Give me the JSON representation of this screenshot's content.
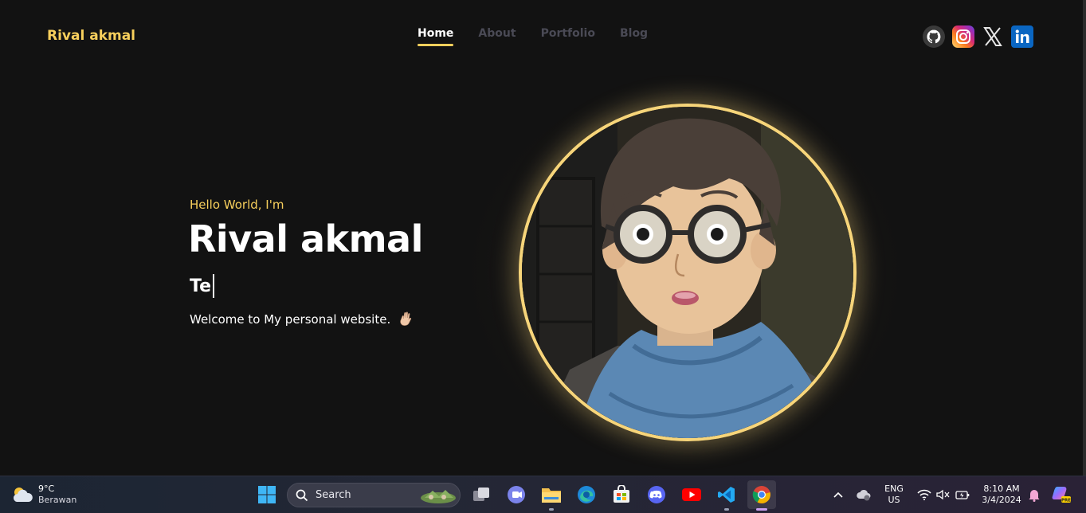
{
  "site": {
    "brand": "Rival akmal",
    "nav": [
      "Home",
      "About",
      "Portfolio",
      "Blog"
    ],
    "active_nav": "Home",
    "socials": [
      "github-icon",
      "instagram-icon",
      "x-icon",
      "linkedin-icon"
    ],
    "accent_color": "#f7cf5c"
  },
  "hero": {
    "greeting": "Hello World, I'm",
    "name": "Rival akmal",
    "typed_text": "Te",
    "welcome": "Welcome to My personal website."
  },
  "taskbar": {
    "weather": {
      "temp": "9°C",
      "condition": "Berawan"
    },
    "search_label": "Search",
    "apps": [
      "start-icon",
      "task-view-icon",
      "teams-icon",
      "file-explorer-icon",
      "edge-icon",
      "store-icon",
      "discord-icon",
      "youtube-icon",
      "vscode-icon",
      "chrome-icon"
    ],
    "language": {
      "lang": "ENG",
      "region": "US"
    },
    "time": "8:10 AM",
    "date": "3/4/2024"
  }
}
